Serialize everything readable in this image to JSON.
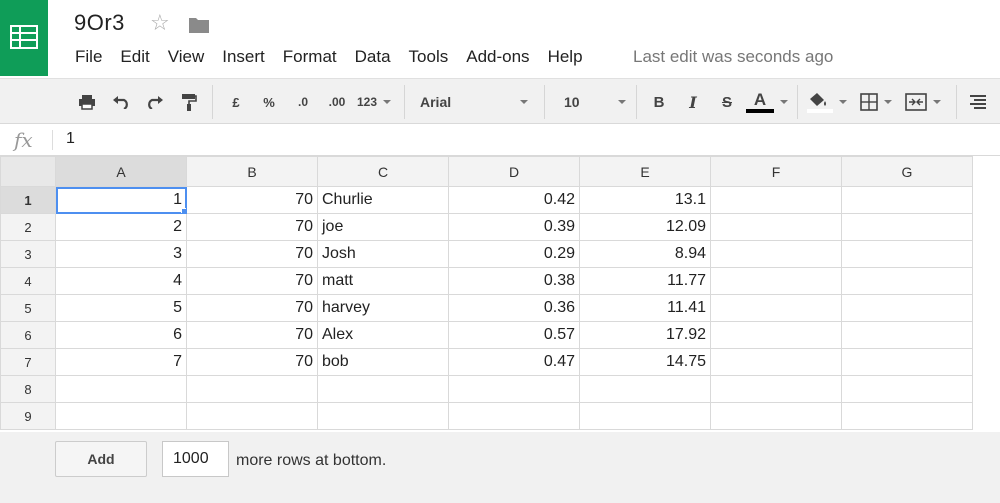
{
  "app": {
    "doc_title": "9Or3",
    "last_edit": "Last edit was seconds ago",
    "brand_color": "#0f9d58"
  },
  "menu": [
    "File",
    "Edit",
    "View",
    "Insert",
    "Format",
    "Data",
    "Tools",
    "Add-ons",
    "Help"
  ],
  "toolbar": {
    "currency": "£",
    "percent": "%",
    "dec_decrease": ".0",
    "dec_increase": ".00",
    "more_formats": "123",
    "font": "Arial",
    "font_size": "10",
    "bold": "B",
    "italic": "I",
    "strike": "S",
    "text_color_label": "A",
    "icons": [
      "print-icon",
      "undo-icon",
      "redo-icon",
      "paint-format-icon",
      "fill-color-icon",
      "borders-icon",
      "merge-cells-icon",
      "align-icon"
    ]
  },
  "formula_bar": {
    "fx_label": "fx",
    "value": "1"
  },
  "sheet": {
    "columns": [
      "A",
      "B",
      "C",
      "D",
      "E",
      "F",
      "G"
    ],
    "row_numbers": [
      "1",
      "2",
      "3",
      "4",
      "5",
      "6",
      "7",
      "8",
      "9"
    ],
    "rows": [
      [
        "1",
        "70",
        "Churlie",
        "0.42",
        "13.1",
        "",
        ""
      ],
      [
        "2",
        "70",
        "joe",
        "0.39",
        "12.09",
        "",
        ""
      ],
      [
        "3",
        "70",
        "Josh",
        "0.29",
        "8.94",
        "",
        ""
      ],
      [
        "4",
        "70",
        "matt",
        "0.38",
        "11.77",
        "",
        ""
      ],
      [
        "5",
        "70",
        "harvey",
        "0.36",
        "11.41",
        "",
        ""
      ],
      [
        "6",
        "70",
        "Alex",
        "0.57",
        "17.92",
        "",
        ""
      ],
      [
        "7",
        "70",
        "bob",
        "0.47",
        "14.75",
        "",
        ""
      ],
      [
        "",
        "",
        "",
        "",
        "",
        "",
        ""
      ],
      [
        "",
        "",
        "",
        "",
        "",
        "",
        ""
      ]
    ],
    "active_cell": "A1"
  },
  "footer": {
    "add_label": "Add",
    "rows_value": "1000",
    "rows_suffix": "more rows at bottom."
  }
}
